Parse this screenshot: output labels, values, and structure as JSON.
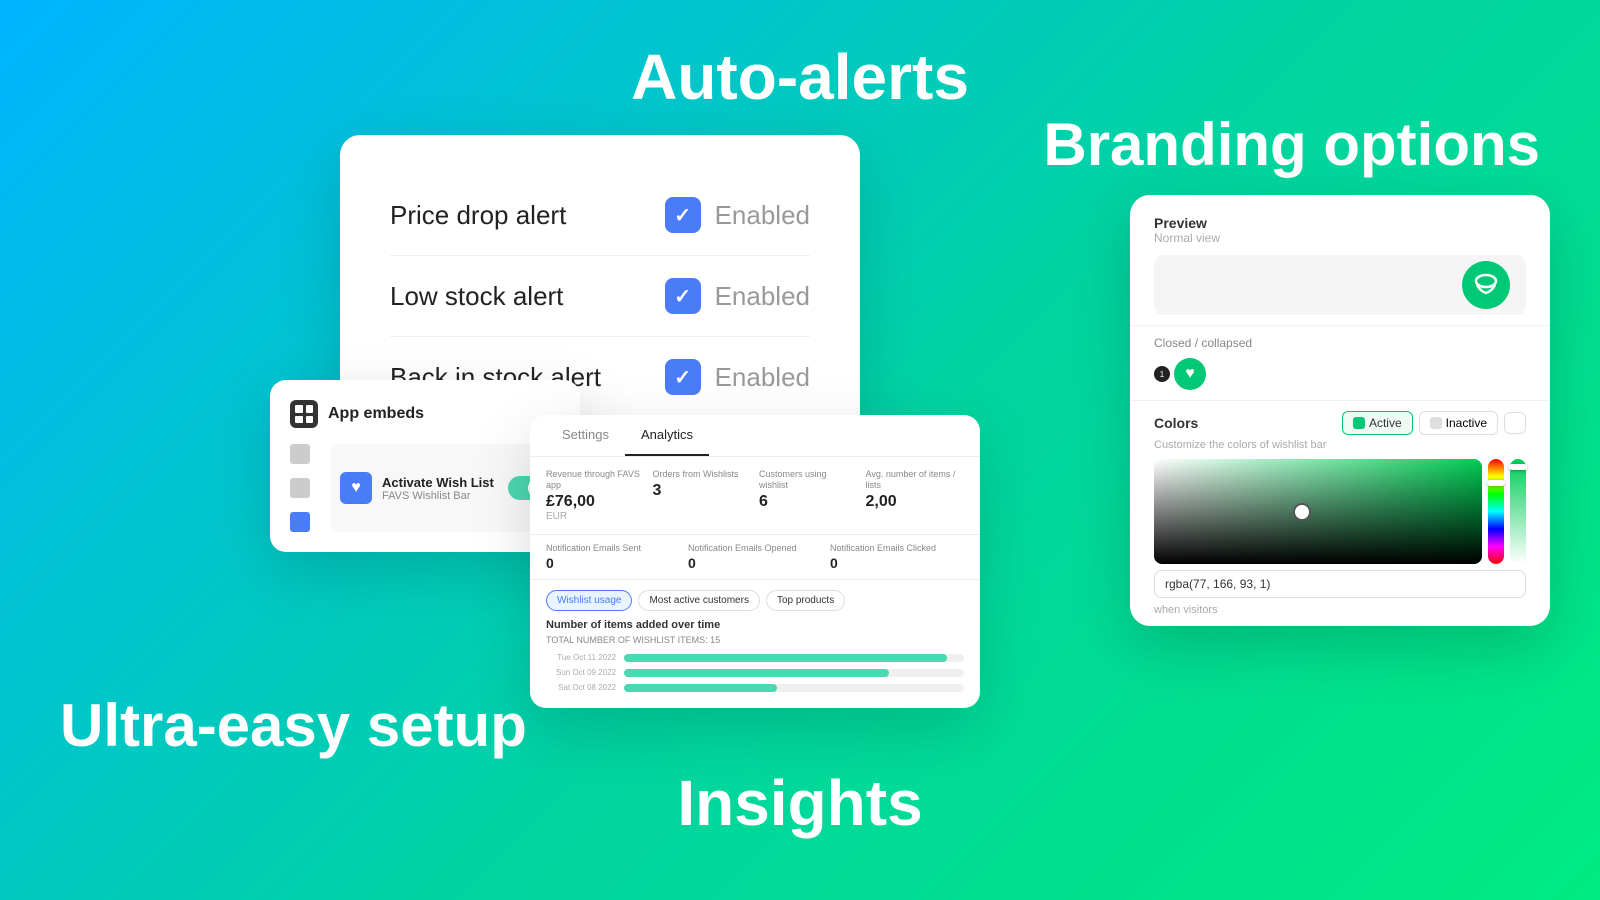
{
  "background": {
    "gradient_start": "#00aaff",
    "gradient_end": "#00e887"
  },
  "titles": {
    "auto_alerts": "Auto-alerts",
    "branding_options": "Branding options",
    "ultra_easy_setup": "Ultra-easy setup",
    "insights": "Insights"
  },
  "alerts_card": {
    "rows": [
      {
        "label": "Price drop alert",
        "status": "Enabled"
      },
      {
        "label": "Low stock alert",
        "status": "Enabled"
      },
      {
        "label": "Back in stock alert",
        "status": "Enabled"
      }
    ]
  },
  "embeds_card": {
    "title": "App embeds",
    "item_name": "Activate Wish List",
    "item_sub": "FAVS Wishlist Bar"
  },
  "analytics_card": {
    "tabs": [
      "Settings",
      "Analytics"
    ],
    "active_tab": "Analytics",
    "stats": [
      {
        "label": "Revenue through FAVS app",
        "value": "£76,00",
        "sub": "EUR"
      },
      {
        "label": "Orders from Wishlists",
        "value": "3",
        "sub": ""
      },
      {
        "label": "Customers using wishlist",
        "value": "6",
        "sub": ""
      },
      {
        "label": "Avg. number of items / lists",
        "value": "2,00",
        "sub": ""
      }
    ],
    "notifications": [
      {
        "label": "Notification Emails Sent",
        "value": "0"
      },
      {
        "label": "Notification Emails Opened",
        "value": "0"
      },
      {
        "label": "Notification Emails Clicked",
        "value": "0"
      }
    ],
    "chart_tabs": [
      "Wishlist usage",
      "Most active customers",
      "Top products"
    ],
    "active_chart_tab": "Wishlist usage",
    "chart_title": "Number of items added over time",
    "chart_subtitle": "TOTAL NUMBER OF WISHLIST ITEMS: 15",
    "chart_rows": [
      {
        "date": "Tue Oct 11 2022",
        "pct": 95
      },
      {
        "date": "Sun Oct 09 2022",
        "pct": 78
      },
      {
        "date": "Sat Oct 08 2022",
        "pct": 45
      }
    ]
  },
  "branding_card": {
    "preview_label": "Preview",
    "preview_sublabel": "Normal view",
    "collapsed_label": "Closed / collapsed",
    "colors_title": "Colors",
    "colors_desc": "Customize the colors of wishlist bar",
    "active_btn": "Active",
    "inactive_btn": "Inactive",
    "color_value": "rgba(77, 166, 93, 1)",
    "more_text": "when visitors"
  }
}
